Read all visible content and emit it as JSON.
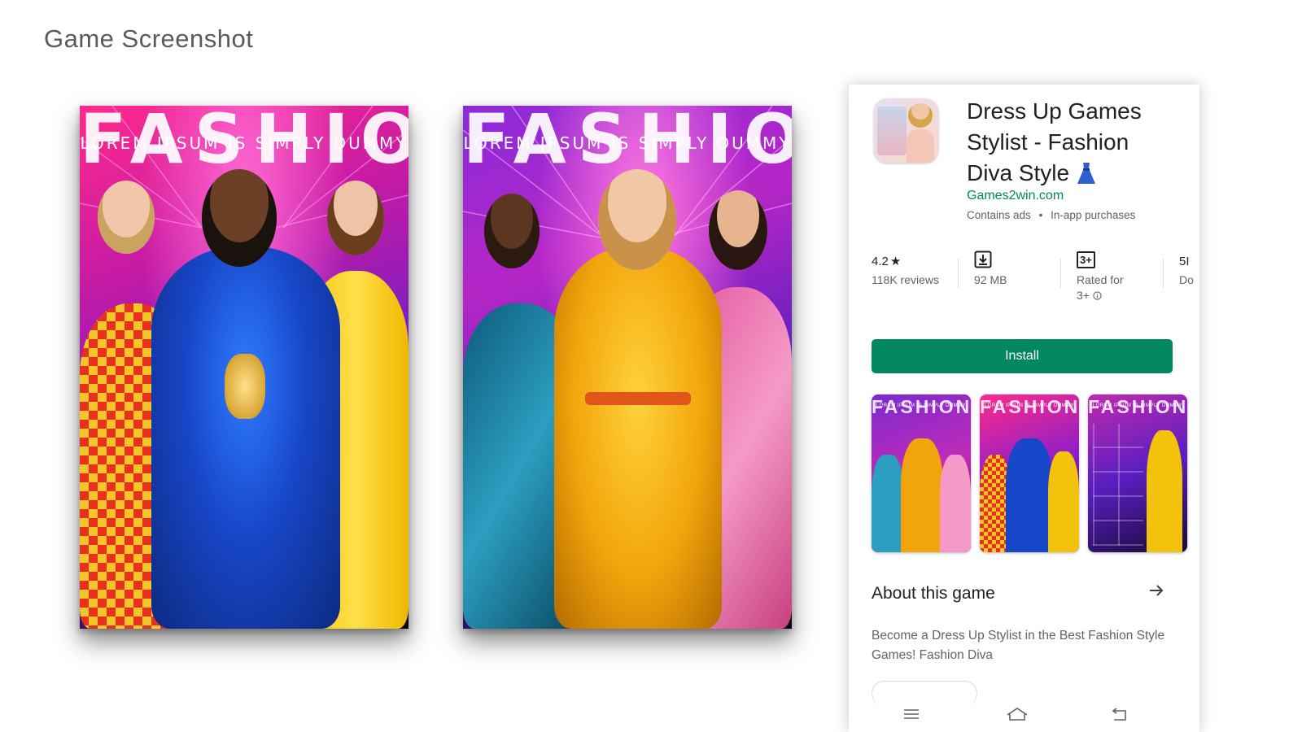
{
  "page": {
    "title": "Game Screenshot"
  },
  "screenshots": [
    {
      "heading": "FASHION",
      "subheading": "LOREM IPSUM IS SIMPLY DUMMY"
    },
    {
      "heading": "FASHION",
      "subheading": "LOREM IPSUM IS SIMPLY DUMMY"
    }
  ],
  "store": {
    "app_title_line1": "Dress Up Games",
    "app_title_line2": "Stylist - Fashion",
    "app_title_line3": "Diva Style",
    "developer": "Games2win.com",
    "meta_ads": "Contains ads",
    "meta_iap": "In-app purchases",
    "stats": {
      "rating_value": "4.2",
      "rating_star": "★",
      "reviews": "118K reviews",
      "size": "92 MB",
      "age_badge": "3+",
      "rated_for": "Rated for",
      "rated_value": "3+",
      "downloads_top": "5I",
      "downloads_label": "Do"
    },
    "install_label": "Install",
    "thumbnails": [
      {
        "heading": "FASHION",
        "subheading": "LOREM IPSUM IS SIMPLY DUMMY"
      },
      {
        "heading": "FASHION",
        "subheading": "LOREM IPSUM IS SIMPLY DUMMY"
      },
      {
        "heading": "FASHION",
        "subheading": "LOREM IPSUM IS SIMPLY DUMMY"
      }
    ],
    "about_heading": "About this game",
    "about_text": "Become a Dress Up Stylist in the Best Fashion Style Games! Fashion Diva",
    "colors": {
      "install_green": "#01875f",
      "developer_green": "#01875f"
    },
    "nav_icons": [
      "menu-icon",
      "home-icon",
      "back-icon"
    ]
  }
}
